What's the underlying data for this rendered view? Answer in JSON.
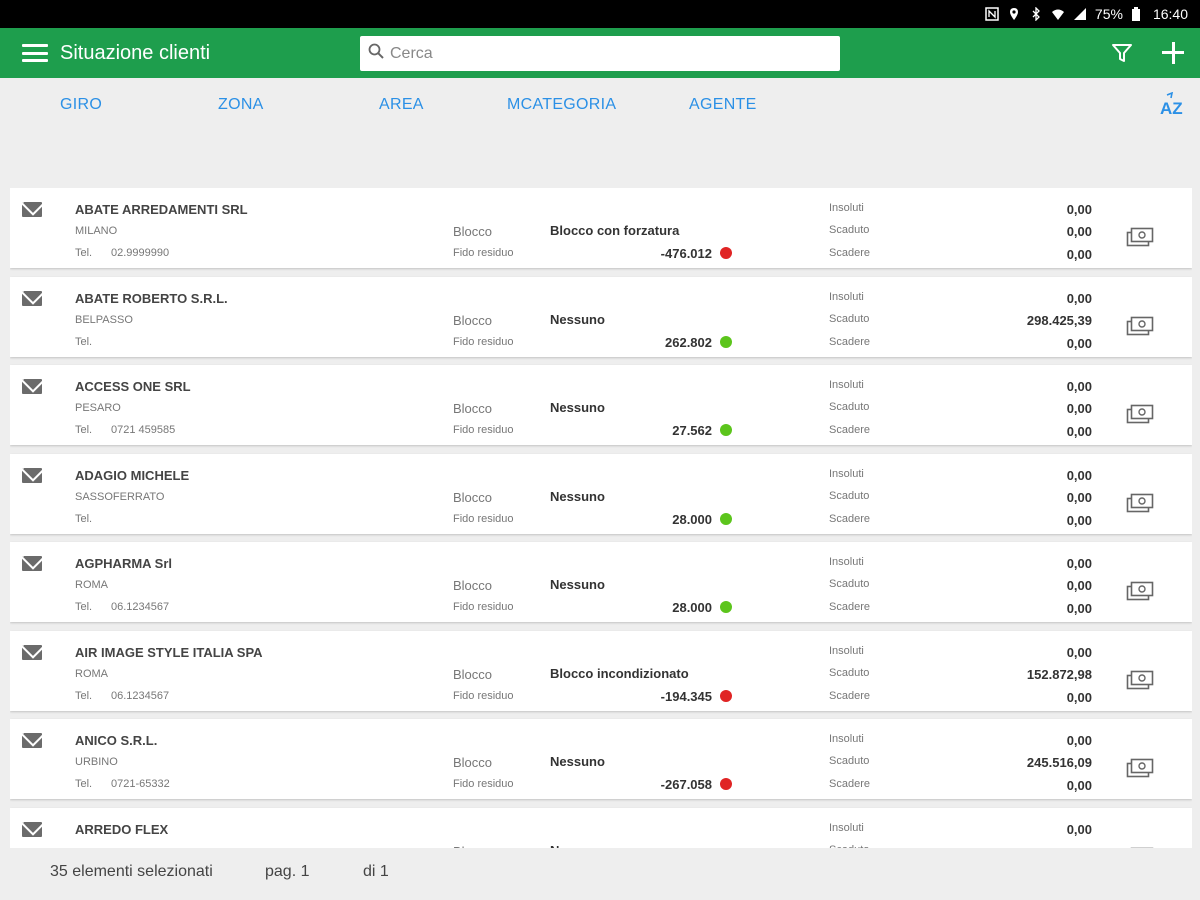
{
  "statusbar": {
    "battery": "75%",
    "time": "16:40"
  },
  "appbar": {
    "title": "Situazione clienti",
    "search_placeholder": "Cerca"
  },
  "tabs": [
    "GIRO",
    "ZONA",
    "AREA",
    "MCATEGORIA",
    "AGENTE"
  ],
  "sort_label": "AZ",
  "labels": {
    "tel": "Tel.",
    "blocco": "Blocco",
    "fido": "Fido residuo",
    "insoluti": "Insoluti",
    "scaduto": "Scaduto",
    "scadere": "Scadere"
  },
  "colors": {
    "appbar": "#1e9e4d",
    "accent": "#2b90e6",
    "status_red": "#e02424",
    "status_green": "#5cc51c"
  },
  "clients": [
    {
      "name": "ABATE ARREDAMENTI SRL",
      "city": "MILANO",
      "tel": "02.9999990",
      "blocco": "Blocco con forzatura",
      "fido": "-476.012",
      "status": "red",
      "insoluti": "0,00",
      "scaduto": "0,00",
      "scadere": "0,00"
    },
    {
      "name": "ABATE ROBERTO S.R.L.",
      "city": "BELPASSO",
      "tel": "",
      "blocco": "Nessuno",
      "fido": "262.802",
      "status": "green",
      "insoluti": "0,00",
      "scaduto": "298.425,39",
      "scadere": "0,00"
    },
    {
      "name": "ACCESS ONE SRL",
      "city": "PESARO",
      "tel": "0721 459585",
      "blocco": "Nessuno",
      "fido": "27.562",
      "status": "green",
      "insoluti": "0,00",
      "scaduto": "0,00",
      "scadere": "0,00"
    },
    {
      "name": "ADAGIO MICHELE",
      "city": "SASSOFERRATO",
      "tel": "",
      "blocco": "Nessuno",
      "fido": "28.000",
      "status": "green",
      "insoluti": "0,00",
      "scaduto": "0,00",
      "scadere": "0,00"
    },
    {
      "name": "AGPHARMA Srl",
      "city": "ROMA",
      "tel": "06.1234567",
      "blocco": "Nessuno",
      "fido": "28.000",
      "status": "green",
      "insoluti": "0,00",
      "scaduto": "0,00",
      "scadere": "0,00"
    },
    {
      "name": "AIR IMAGE STYLE ITALIA SPA",
      "city": "ROMA",
      "tel": "06.1234567",
      "blocco": "Blocco incondizionato",
      "fido": "-194.345",
      "status": "red",
      "insoluti": "0,00",
      "scaduto": "152.872,98",
      "scadere": "0,00"
    },
    {
      "name": "ANICO S.R.L.",
      "city": "URBINO",
      "tel": "0721-65332",
      "blocco": "Nessuno",
      "fido": "-267.058",
      "status": "red",
      "insoluti": "0,00",
      "scaduto": "245.516,09",
      "scadere": "0,00"
    },
    {
      "name": "ARREDO FLEX",
      "city": "",
      "tel": "",
      "blocco": "Nessuno",
      "fido": "",
      "status": "",
      "insoluti": "0,00",
      "scaduto": "",
      "scadere": ""
    }
  ],
  "footer": {
    "count": "35 elementi selezionati",
    "page": "pag. 1",
    "of": "di 1"
  }
}
